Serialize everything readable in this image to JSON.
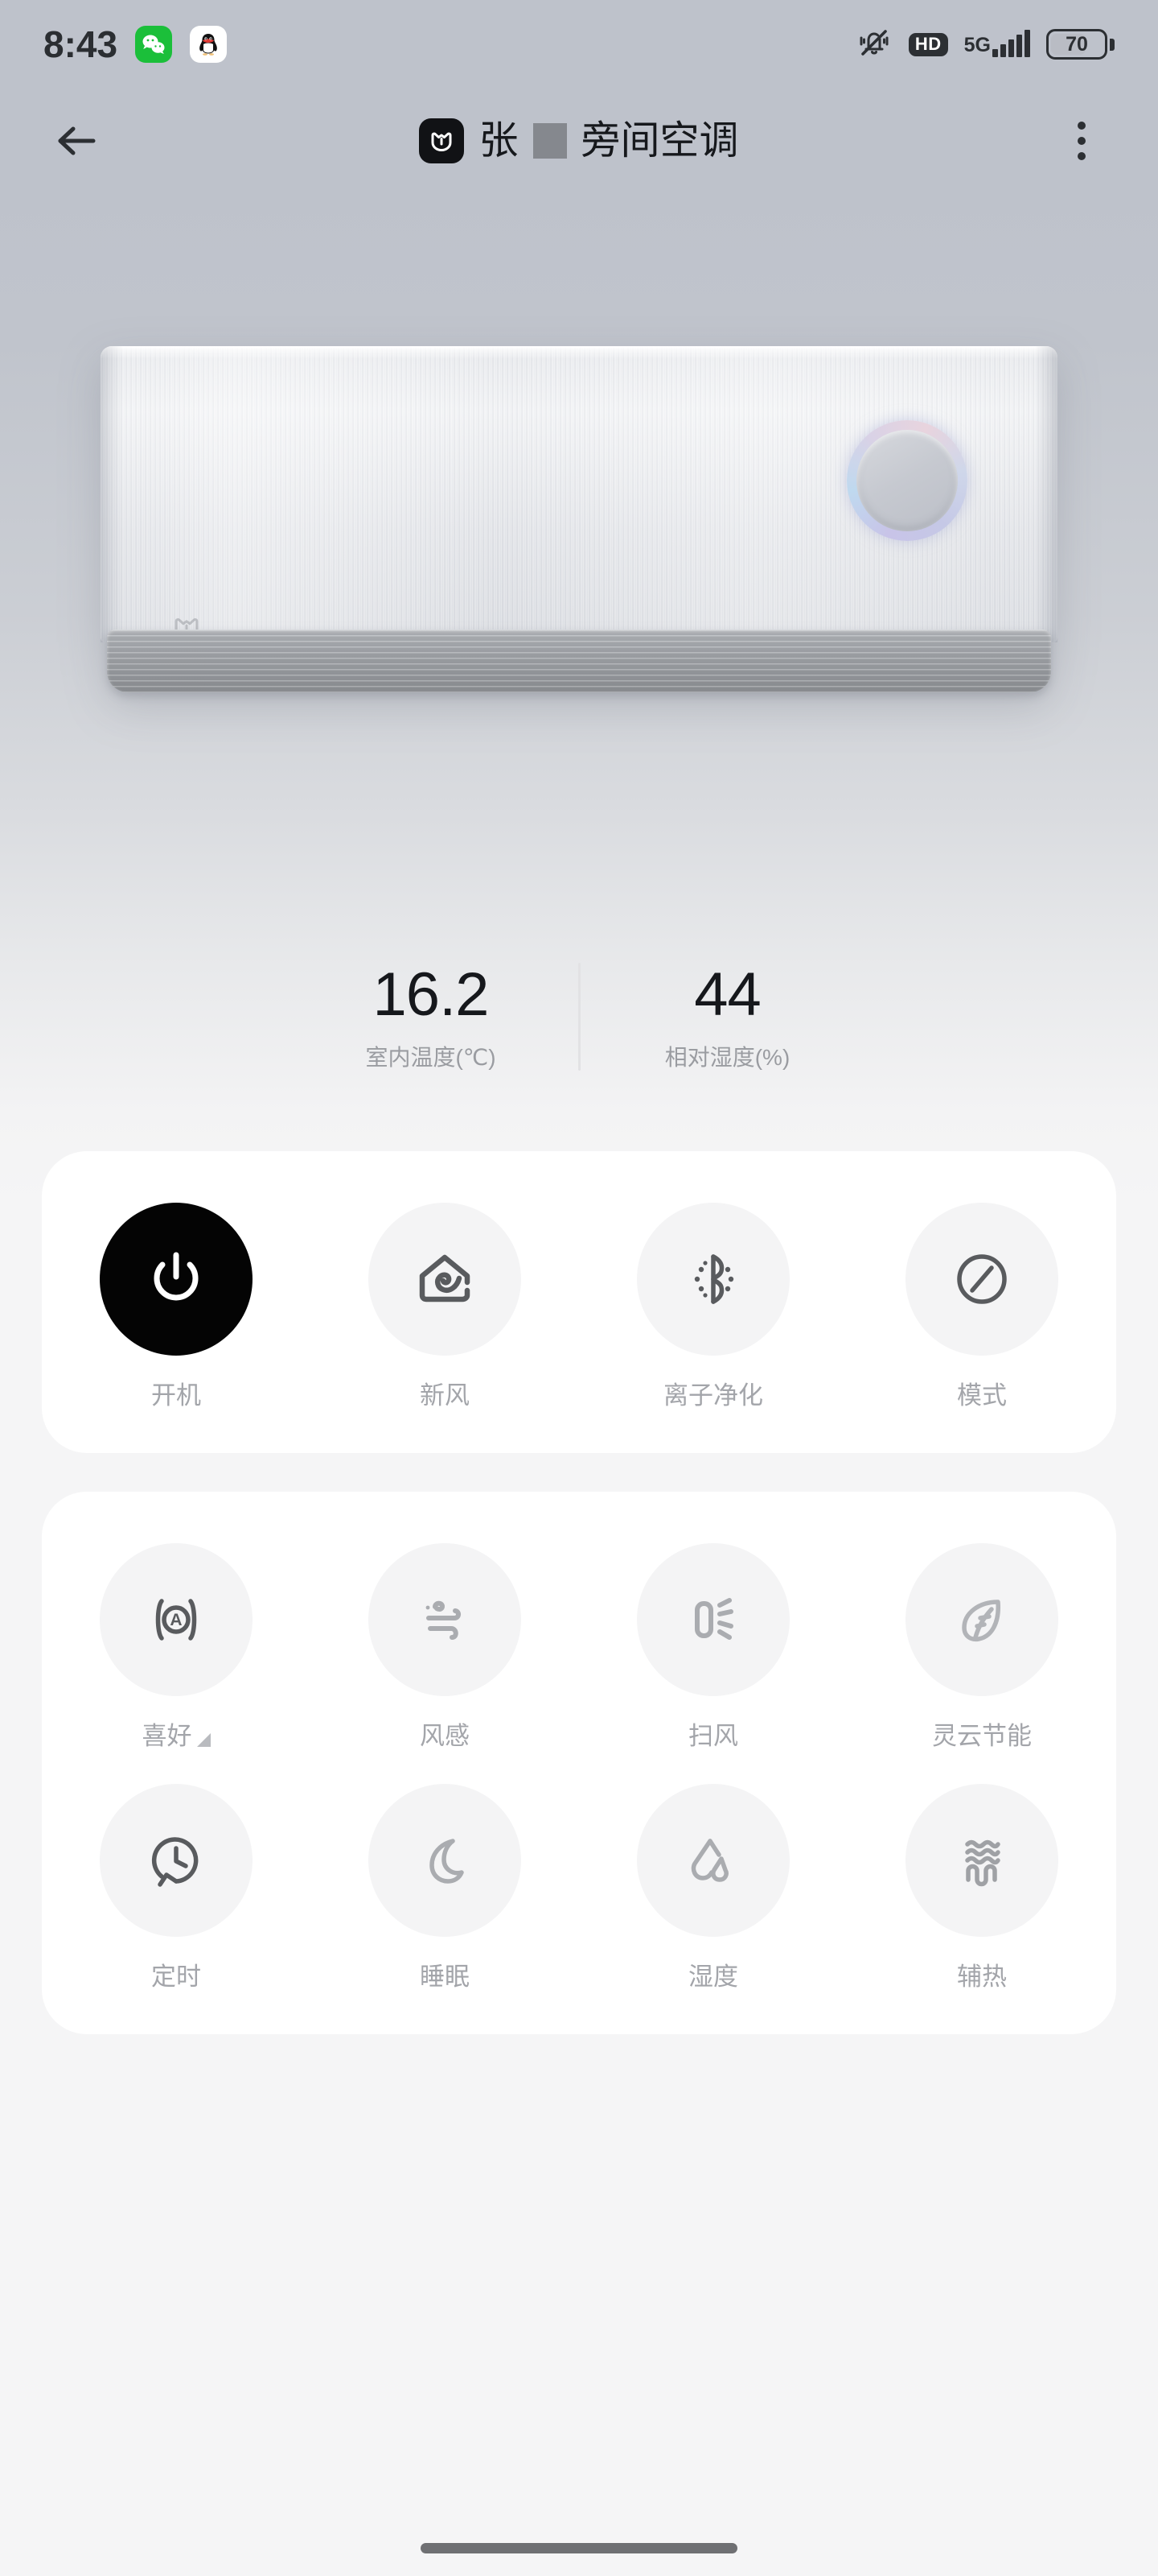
{
  "statusbar": {
    "time": "8:43",
    "app_icons": [
      {
        "name": "wechat-icon",
        "label": "WeChat"
      },
      {
        "name": "qq-icon",
        "label": "QQ"
      }
    ],
    "mute_icon": "bell-mute-icon",
    "hd_badge": "HD",
    "network": "5G",
    "signal_bars": 5,
    "battery_percent": "70"
  },
  "header": {
    "back_icon": "back-arrow-icon",
    "brand_icon": "mijia-logo-icon",
    "owner_name": "张",
    "redacted_block": "",
    "device_name": "旁间空调",
    "menu_icon": "more-vertical-icon"
  },
  "device": {
    "type": "wall-mounted-air-conditioner",
    "brand_mark": "mijia-mark",
    "knob_icon": "status-ring-icon"
  },
  "readings": [
    {
      "value": "16.2",
      "label": "室内温度(℃)",
      "name": "indoor-temperature"
    },
    {
      "value": "44",
      "label": "相对湿度(%)",
      "name": "relative-humidity"
    }
  ],
  "main_controls": [
    {
      "label": "开机",
      "icon": "power-icon",
      "active": true,
      "name": "power"
    },
    {
      "label": "新风",
      "icon": "fresh-air-house-icon",
      "active": false,
      "name": "fresh-air"
    },
    {
      "label": "离子净化",
      "icon": "ion-purify-icon",
      "active": false,
      "name": "ion-purify"
    },
    {
      "label": "模式",
      "icon": "mode-slash-circle-icon",
      "active": false,
      "name": "mode"
    }
  ],
  "secondary_controls": [
    {
      "label": "喜好",
      "icon": "auto-preference-icon",
      "active": false,
      "name": "preference",
      "has_expand": true
    },
    {
      "label": "风感",
      "icon": "wind-feel-icon",
      "active": false,
      "name": "wind-feel",
      "has_expand": false
    },
    {
      "label": "扫风",
      "icon": "swing-air-icon",
      "active": false,
      "name": "swing-air",
      "has_expand": false
    },
    {
      "label": "灵云节能",
      "icon": "leaf-eco-icon",
      "active": false,
      "name": "eco-saving",
      "has_expand": false
    },
    {
      "label": "定时",
      "icon": "timer-clock-icon",
      "active": false,
      "name": "timer",
      "has_expand": false
    },
    {
      "label": "睡眠",
      "icon": "moon-sleep-icon",
      "active": false,
      "name": "sleep",
      "has_expand": false
    },
    {
      "label": "湿度",
      "icon": "humidity-drop-icon",
      "active": false,
      "name": "humidity",
      "has_expand": false
    },
    {
      "label": "辅热",
      "icon": "aux-heat-coil-icon",
      "active": false,
      "name": "aux-heat",
      "has_expand": false
    }
  ],
  "colors": {
    "accent_active": "#040404",
    "icon_inactive": "#6b6c6e",
    "label": "#a3a5aa",
    "card_bg": "#ffffff",
    "page_bg_top": "#bec2cb",
    "page_bg_bottom": "#f5f5f6"
  },
  "home_indicator": "home-indicator-bar"
}
